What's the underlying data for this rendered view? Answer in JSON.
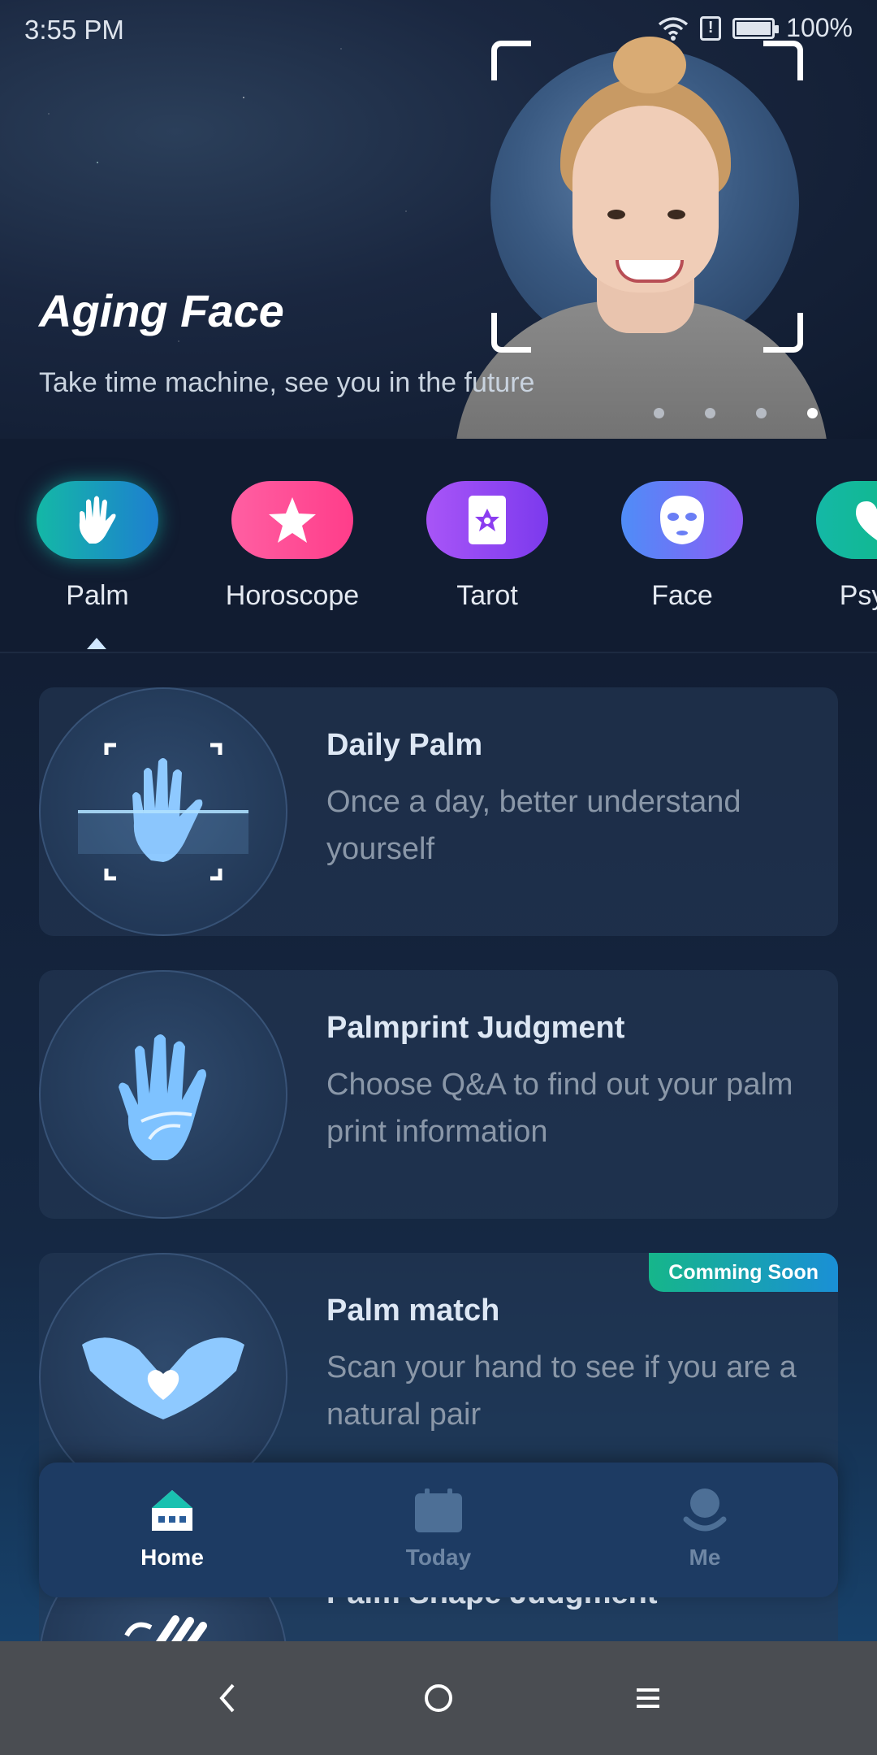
{
  "status_bar": {
    "time": "3:55 PM",
    "battery": "100%"
  },
  "banner": {
    "title": "Aging Face",
    "subtitle": "Take time machine, see you in the future",
    "dot_count": 4,
    "active_dot": 4
  },
  "categories": [
    {
      "label": "Palm",
      "icon": "hand-icon",
      "color": [
        "#14b8a6",
        "#1d7fd0"
      ],
      "selected": true
    },
    {
      "label": "Horoscope",
      "icon": "star-icon",
      "color": [
        "#ff5fa2",
        "#ff3d8a"
      ],
      "selected": false
    },
    {
      "label": "Tarot",
      "icon": "tarot-card-icon",
      "color": [
        "#a855f7",
        "#7c3aed"
      ],
      "selected": false
    },
    {
      "label": "Face",
      "icon": "face-mask-icon",
      "color": [
        "#4f8df7",
        "#8b5cf6"
      ],
      "selected": false
    },
    {
      "label": "Psych",
      "icon": "heart-icon",
      "color": [
        "#14b8a6",
        "#10b981"
      ],
      "selected": false
    }
  ],
  "cards": [
    {
      "title": "Daily Palm",
      "desc": "Once a day, better understand yourself",
      "icon": "scan-hand-icon"
    },
    {
      "title": "Palmprint Judgment",
      "desc": "Choose Q&A to find out your palm print information",
      "icon": "palm-lines-icon"
    },
    {
      "title": "Palm match",
      "desc": "Scan your hand to see if you are a natural pair",
      "icon": "heart-hands-icon",
      "badge": "Comming Soon"
    },
    {
      "title": "Palm Shape Judgment",
      "desc": "",
      "icon": "palm-shape-icon"
    }
  ],
  "tabbar": {
    "items": [
      {
        "label": "Home",
        "icon": "home-icon",
        "active": true
      },
      {
        "label": "Today",
        "icon": "calendar-icon",
        "active": false
      },
      {
        "label": "Me",
        "icon": "person-icon",
        "active": false
      }
    ],
    "active_color": "#ffffff",
    "inactive_color": "#6e86a4"
  },
  "navbar": {
    "back": "back-icon",
    "home": "home-circle-icon",
    "menu": "menu-icon"
  }
}
